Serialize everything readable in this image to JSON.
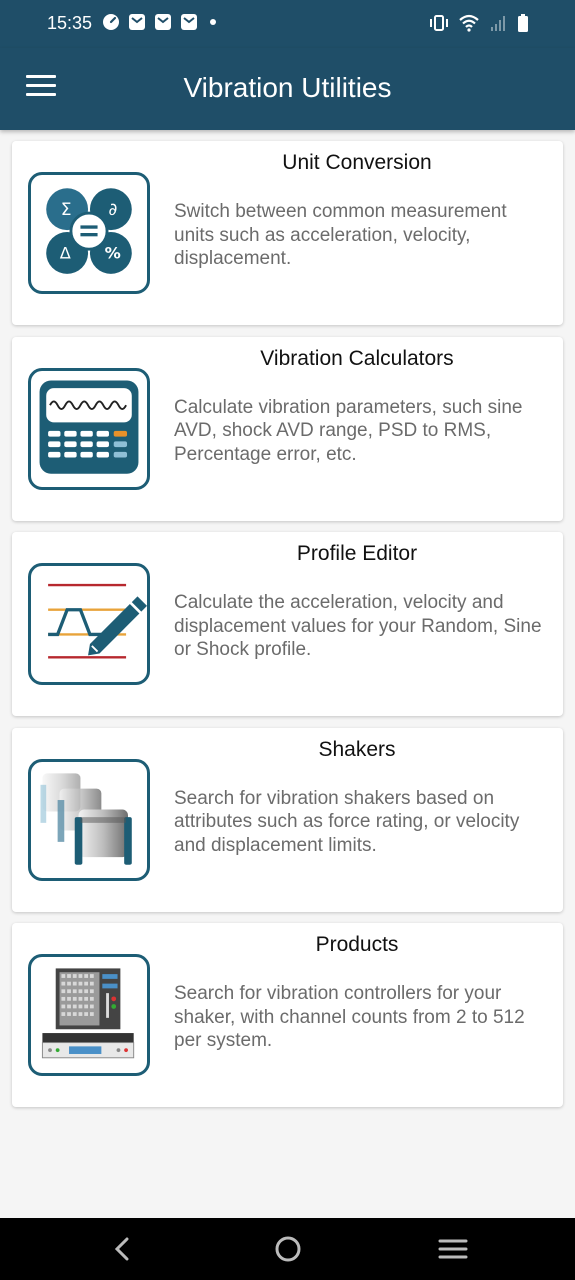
{
  "status_bar": {
    "time": "15:35",
    "left_icons": [
      "speed-icon",
      "mail-icon",
      "mail-icon",
      "mail-icon",
      "dot-icon"
    ],
    "right_icons": [
      "vibrate-icon",
      "wifi-icon",
      "signal-icon",
      "battery-icon"
    ]
  },
  "app_bar": {
    "title": "Vibration Utilities",
    "menu_icon": "menu-icon"
  },
  "items": [
    {
      "title": "Unit Conversion",
      "description": "Switch between common measurement units such as acceleration, velocity, displacement.",
      "icon": "unit-conversion-icon"
    },
    {
      "title": "Vibration Calculators",
      "description": "Calculate vibration parameters, such sine AVD, shock AVD range, PSD to RMS, Percentage error, etc.",
      "icon": "calculator-icon"
    },
    {
      "title": "Profile Editor",
      "description": "Calculate the acceleration, velocity and displacement values for your Random, Sine or Shock profile.",
      "icon": "profile-editor-icon"
    },
    {
      "title": "Shakers",
      "description": "Search for vibration shakers based on attributes such as force rating, or velocity and displacement limits.",
      "icon": "shakers-icon"
    },
    {
      "title": "Products",
      "description": "Search for vibration controllers for your shaker, with channel counts from 2 to 512 per system.",
      "icon": "products-icon"
    }
  ],
  "nav_bar": {
    "icons": [
      "back-icon",
      "home-icon",
      "recents-icon"
    ]
  },
  "colors": {
    "primary": "#1f4e68",
    "icon_border": "#1d5d75",
    "background": "#f5f5f5"
  }
}
